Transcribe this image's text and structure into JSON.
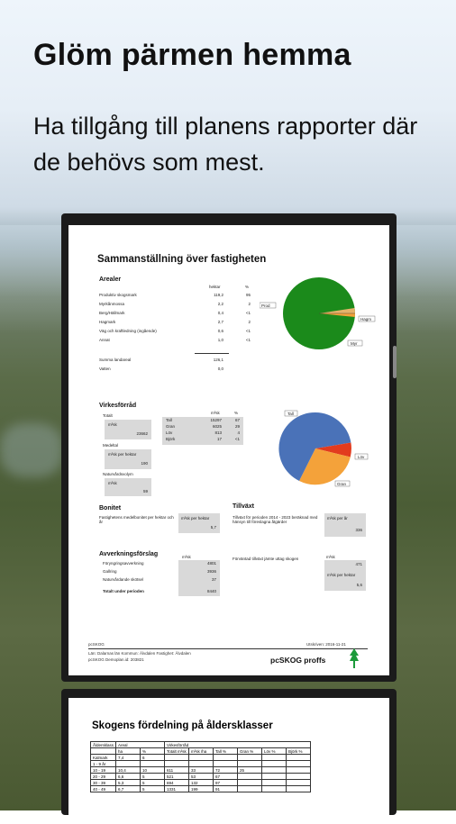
{
  "promo": {
    "title": "Glöm pärmen hemma",
    "subtitle": "Ha tillgång till planens rapporter där de behövs som mest."
  },
  "report1": {
    "heading": "Sammanställning över fastigheten",
    "areas": {
      "title": "Arealer",
      "col_hektar": "hektar",
      "col_pct": "%",
      "rows": [
        {
          "label": "Produktiv skogsmark",
          "ha": "119,2",
          "pct": "95"
        },
        {
          "label": "Myrkånmossa",
          "ha": "2,2",
          "pct": "2"
        },
        {
          "label": "Berg/Hällmark",
          "ha": "0,4",
          "pct": "<1"
        },
        {
          "label": "Hagmark",
          "ha": "2,7",
          "pct": "2"
        },
        {
          "label": "Väg och kraftledning (ingående)",
          "ha": "0,6",
          "pct": "<1"
        },
        {
          "label": "Annat",
          "ha": "1,0",
          "pct": "<1"
        }
      ],
      "sum_label": "Summa landareal",
      "sum_value": "126,1",
      "water_label": "Vatten",
      "water_value": "0,0"
    },
    "pie1_labels": {
      "a": "Prod",
      "b": "Hagm",
      "c": "Myr"
    },
    "volume": {
      "title": "Virkesförråd",
      "total_label": "Totalt",
      "total_unit": "m³sk",
      "total_value": "23662",
      "mean_label": "Medeltal",
      "mean_unit": "m³sk per hektar",
      "mean_value": "190",
      "reserve_label": "Naturvårdsvolym",
      "reserve_unit": "m³sk",
      "reserve_value": "59",
      "col_m3": "m³sk",
      "col_pct": "%",
      "species": [
        {
          "name": "Tall",
          "m3": "15297",
          "pct": "67"
        },
        {
          "name": "Gran",
          "m3": "6025",
          "pct": "29"
        },
        {
          "name": "Löv",
          "m3": "813",
          "pct": "4"
        },
        {
          "name": "Björk",
          "m3": "17",
          "pct": "<1"
        }
      ]
    },
    "pie2_labels": {
      "a": "Tall",
      "b": "Löv",
      "c": "Gran"
    },
    "bonitet": {
      "title": "Bonitet",
      "text": "Fastighetens medelbonitet per hektar och år",
      "unit": "m³sk per hektar",
      "value": "5,7"
    },
    "tillvaxt": {
      "title": "Tillväxt",
      "text": "Tillväxt för perioden 2014 - 2023 beräknad med hänsyn till föreslagna åtgärder",
      "unit": "m³sk per år",
      "value": "336"
    },
    "avverkning": {
      "title": "Avverkningsförslag",
      "unit": "m³sk",
      "rows": [
        {
          "label": "Föryngringsavverkning",
          "value": "4801"
        },
        {
          "label": "Gallring",
          "value": "3936"
        },
        {
          "label": "Naturvårdande skötsel",
          "value": "37"
        }
      ],
      "total_label": "Totalt under perioden",
      "total_value": "8440",
      "aside_text": "Förväntad tillväxt jämte uttag skogen",
      "aside_unit1": "m³sk",
      "aside_value1": "471",
      "aside_unit2": "m³sk per hektar",
      "aside_value2": "5,6"
    },
    "footer": {
      "left": "pcSKOG",
      "date": "Utskriven: 2016-11-21",
      "line1": "Län: Dalarnas län  Kommun: Älvdalen  Fastighet: Älvdalen",
      "line2": "pcSKOG Demoplan.id: 203821",
      "brand": "pcSKOG proffs"
    }
  },
  "report2": {
    "heading": "Skogens fördelning på åldersklasser",
    "table_header1": [
      "Åldersklass",
      "Areal",
      "",
      "Virkesförråd"
    ],
    "table_header2": [
      "",
      "ha",
      "%",
      "Totalt m³sk",
      "m³sk /ha",
      "Tall %",
      "Gran %",
      "Löv %",
      "Björk %"
    ],
    "rows": [
      [
        "Kalmark",
        "7,4",
        "6",
        "",
        "",
        "",
        "",
        "",
        ""
      ],
      [
        "1 - 9 år",
        "",
        "",
        "",
        "",
        "",
        "",
        "",
        ""
      ],
      [
        "10 - 19",
        "10,4",
        "10",
        "611",
        "33",
        "72",
        "25",
        "",
        ""
      ],
      [
        "20 - 29",
        "6,6",
        "5",
        "521",
        "53",
        "67",
        "",
        "",
        ""
      ],
      [
        "30 - 39",
        "5,3",
        "5",
        "694",
        "132",
        "97",
        "",
        "",
        ""
      ],
      [
        "40 - 49",
        "6,7",
        "5",
        "1331",
        "199",
        "91",
        "",
        "",
        ""
      ]
    ]
  },
  "colors": {
    "pie_green": "#1b8a1b",
    "pie_orange": "#f4a23a",
    "pie_blue": "#4a72b8",
    "pie_red": "#e23b1e",
    "pie_tan": "#e6b36a"
  }
}
